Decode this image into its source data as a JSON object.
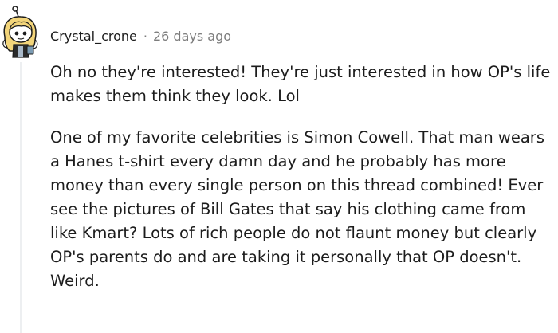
{
  "comment": {
    "author": "Crystal_crone",
    "separator": "·",
    "timestamp": "26 days ago",
    "paragraphs": [
      "Oh no they're interested! They're just interested in how OP's life makes them think they look. Lol",
      "One of my favorite celebrities is Simon Cowell. That man wears a Hanes t-shirt every damn day and he probably has more money than every single person on this thread combined! Ever see the pictures of Bill Gates that say his clothing came from like Kmart? Lots of rich people do not flaunt money but clearly OP's parents do and are taking it personally that OP doesn't. Weird."
    ]
  }
}
